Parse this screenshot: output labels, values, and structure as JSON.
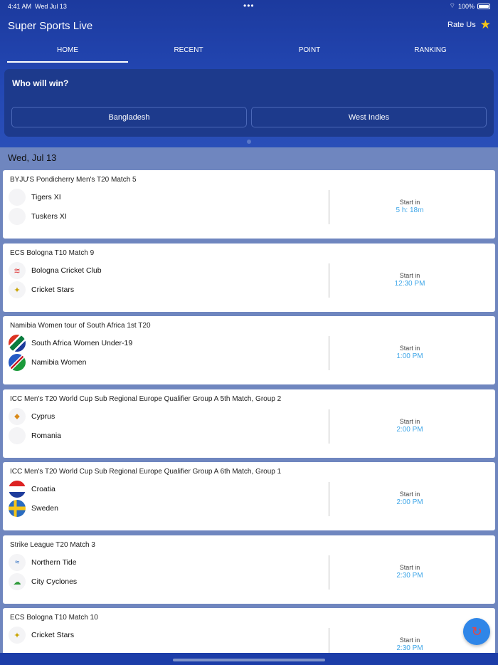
{
  "status": {
    "time": "4:41 AM",
    "date": "Wed Jul 13",
    "battery": "100%"
  },
  "app": {
    "title": "Super Sports Live",
    "rate_label": "Rate Us"
  },
  "tabs": [
    {
      "label": "HOME",
      "active": true
    },
    {
      "label": "RECENT",
      "active": false
    },
    {
      "label": "POINT",
      "active": false
    },
    {
      "label": "RANKING",
      "active": false
    }
  ],
  "poll": {
    "question": "Who will win?",
    "options": [
      "Bangladesh",
      "West Indies"
    ]
  },
  "date_header": "Wed, Jul 13",
  "matches": [
    {
      "title": "BYJU'S Pondicherry Men's T20 Match 5",
      "team1": "Tigers XI",
      "team2": "Tuskers XI",
      "start_label": "Start in",
      "start_value": "5 h: 18m"
    },
    {
      "title": "ECS Bologna T10 Match 9",
      "team1": "Bologna Cricket Club",
      "team2": "Cricket Stars",
      "start_label": "Start in",
      "start_value": "12:30 PM"
    },
    {
      "title": "Namibia Women tour of South Africa 1st T20",
      "team1": "South Africa Women Under-19",
      "team2": "Namibia Women",
      "start_label": "Start in",
      "start_value": "1:00 PM"
    },
    {
      "title": "ICC Men's T20 World Cup Sub Regional Europe Qualifier Group A 5th Match, Group 2",
      "team1": "Cyprus",
      "team2": "Romania",
      "start_label": "Start in",
      "start_value": "2:00 PM"
    },
    {
      "title": "ICC Men's T20 World Cup Sub Regional Europe Qualifier Group A 6th Match, Group 1",
      "team1": "Croatia",
      "team2": "Sweden",
      "start_label": "Start in",
      "start_value": "2:00 PM"
    },
    {
      "title": "Strike League T20 Match 3",
      "team1": "Northern Tide",
      "team2": "City Cyclones",
      "start_label": "Start in",
      "start_value": "2:30 PM"
    },
    {
      "title": "ECS Bologna T10 Match 10",
      "team1": "Cricket Stars",
      "team2": "",
      "start_label": "Start in",
      "start_value": "2:30 PM"
    }
  ],
  "colors": {
    "header": "#2347b3",
    "accent_time": "#3ea6e8",
    "fab": "#2f86e8"
  }
}
